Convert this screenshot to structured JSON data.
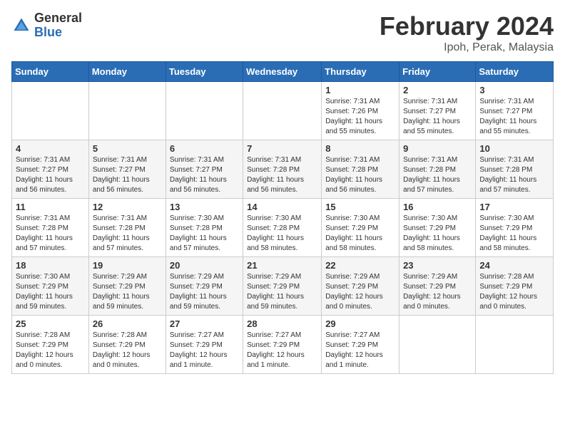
{
  "header": {
    "logo_general": "General",
    "logo_blue": "Blue",
    "title": "February 2024",
    "location": "Ipoh, Perak, Malaysia"
  },
  "weekdays": [
    "Sunday",
    "Monday",
    "Tuesday",
    "Wednesday",
    "Thursday",
    "Friday",
    "Saturday"
  ],
  "weeks": [
    [
      {
        "day": "",
        "info": ""
      },
      {
        "day": "",
        "info": ""
      },
      {
        "day": "",
        "info": ""
      },
      {
        "day": "",
        "info": ""
      },
      {
        "day": "1",
        "info": "Sunrise: 7:31 AM\nSunset: 7:26 PM\nDaylight: 11 hours and 55 minutes."
      },
      {
        "day": "2",
        "info": "Sunrise: 7:31 AM\nSunset: 7:27 PM\nDaylight: 11 hours and 55 minutes."
      },
      {
        "day": "3",
        "info": "Sunrise: 7:31 AM\nSunset: 7:27 PM\nDaylight: 11 hours and 55 minutes."
      }
    ],
    [
      {
        "day": "4",
        "info": "Sunrise: 7:31 AM\nSunset: 7:27 PM\nDaylight: 11 hours and 56 minutes."
      },
      {
        "day": "5",
        "info": "Sunrise: 7:31 AM\nSunset: 7:27 PM\nDaylight: 11 hours and 56 minutes."
      },
      {
        "day": "6",
        "info": "Sunrise: 7:31 AM\nSunset: 7:27 PM\nDaylight: 11 hours and 56 minutes."
      },
      {
        "day": "7",
        "info": "Sunrise: 7:31 AM\nSunset: 7:28 PM\nDaylight: 11 hours and 56 minutes."
      },
      {
        "day": "8",
        "info": "Sunrise: 7:31 AM\nSunset: 7:28 PM\nDaylight: 11 hours and 56 minutes."
      },
      {
        "day": "9",
        "info": "Sunrise: 7:31 AM\nSunset: 7:28 PM\nDaylight: 11 hours and 57 minutes."
      },
      {
        "day": "10",
        "info": "Sunrise: 7:31 AM\nSunset: 7:28 PM\nDaylight: 11 hours and 57 minutes."
      }
    ],
    [
      {
        "day": "11",
        "info": "Sunrise: 7:31 AM\nSunset: 7:28 PM\nDaylight: 11 hours and 57 minutes."
      },
      {
        "day": "12",
        "info": "Sunrise: 7:31 AM\nSunset: 7:28 PM\nDaylight: 11 hours and 57 minutes."
      },
      {
        "day": "13",
        "info": "Sunrise: 7:30 AM\nSunset: 7:28 PM\nDaylight: 11 hours and 57 minutes."
      },
      {
        "day": "14",
        "info": "Sunrise: 7:30 AM\nSunset: 7:28 PM\nDaylight: 11 hours and 58 minutes."
      },
      {
        "day": "15",
        "info": "Sunrise: 7:30 AM\nSunset: 7:29 PM\nDaylight: 11 hours and 58 minutes."
      },
      {
        "day": "16",
        "info": "Sunrise: 7:30 AM\nSunset: 7:29 PM\nDaylight: 11 hours and 58 minutes."
      },
      {
        "day": "17",
        "info": "Sunrise: 7:30 AM\nSunset: 7:29 PM\nDaylight: 11 hours and 58 minutes."
      }
    ],
    [
      {
        "day": "18",
        "info": "Sunrise: 7:30 AM\nSunset: 7:29 PM\nDaylight: 11 hours and 59 minutes."
      },
      {
        "day": "19",
        "info": "Sunrise: 7:29 AM\nSunset: 7:29 PM\nDaylight: 11 hours and 59 minutes."
      },
      {
        "day": "20",
        "info": "Sunrise: 7:29 AM\nSunset: 7:29 PM\nDaylight: 11 hours and 59 minutes."
      },
      {
        "day": "21",
        "info": "Sunrise: 7:29 AM\nSunset: 7:29 PM\nDaylight: 11 hours and 59 minutes."
      },
      {
        "day": "22",
        "info": "Sunrise: 7:29 AM\nSunset: 7:29 PM\nDaylight: 12 hours and 0 minutes."
      },
      {
        "day": "23",
        "info": "Sunrise: 7:29 AM\nSunset: 7:29 PM\nDaylight: 12 hours and 0 minutes."
      },
      {
        "day": "24",
        "info": "Sunrise: 7:28 AM\nSunset: 7:29 PM\nDaylight: 12 hours and 0 minutes."
      }
    ],
    [
      {
        "day": "25",
        "info": "Sunrise: 7:28 AM\nSunset: 7:29 PM\nDaylight: 12 hours and 0 minutes."
      },
      {
        "day": "26",
        "info": "Sunrise: 7:28 AM\nSunset: 7:29 PM\nDaylight: 12 hours and 0 minutes."
      },
      {
        "day": "27",
        "info": "Sunrise: 7:27 AM\nSunset: 7:29 PM\nDaylight: 12 hours and 1 minute."
      },
      {
        "day": "28",
        "info": "Sunrise: 7:27 AM\nSunset: 7:29 PM\nDaylight: 12 hours and 1 minute."
      },
      {
        "day": "29",
        "info": "Sunrise: 7:27 AM\nSunset: 7:29 PM\nDaylight: 12 hours and 1 minute."
      },
      {
        "day": "",
        "info": ""
      },
      {
        "day": "",
        "info": ""
      }
    ]
  ]
}
